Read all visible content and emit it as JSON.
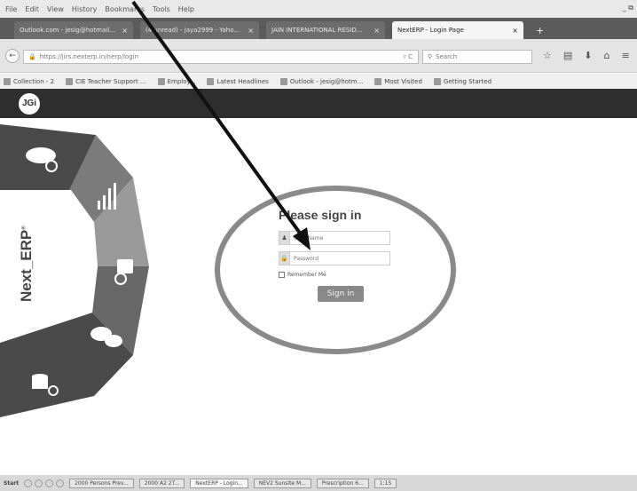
{
  "menubar": {
    "items": [
      "File",
      "Edit",
      "View",
      "History",
      "Bookmarks",
      "Tools",
      "Help"
    ],
    "window_controls": "_ ⧉"
  },
  "tabs": [
    {
      "label": "Outlook.com - jesig@hotmail...",
      "active": false,
      "close": "×"
    },
    {
      "label": "(4 unread) - jaya2999 - Yaho...",
      "active": false,
      "close": "×"
    },
    {
      "label": "JAIN INTERNATIONAL RESID...",
      "active": false,
      "close": "×"
    },
    {
      "label": "NextERP - Login Page",
      "active": true,
      "close": "×"
    }
  ],
  "new_tab": "+",
  "nav": {
    "url": "https://jirs.nexterp.in/nerp/login",
    "search_placeholder": "Search",
    "reload": "▿ C"
  },
  "bookmarks": [
    {
      "label": "Collection - 2"
    },
    {
      "label": "CIE Teacher Support ..."
    },
    {
      "label": "Employ..."
    },
    {
      "label": "Latest Headlines"
    },
    {
      "label": "Outlook - jesig@hotm..."
    },
    {
      "label": "Most Visited"
    },
    {
      "label": "Getting Started"
    }
  ],
  "app": {
    "logo_text": "JGi",
    "brand": "Next_ERP",
    "brand_mark": "®"
  },
  "login": {
    "heading": "Please sign in",
    "username_placeholder": "User Name",
    "password_placeholder": "Password",
    "remember_label": "Remember Me",
    "signin_label": "Sign in"
  },
  "taskbar": {
    "start": "Start",
    "items": [
      {
        "label": "2000 Persons Prev..."
      },
      {
        "label": "2000 A2 2T..."
      },
      {
        "label": "NextERP - Login...",
        "active": true
      },
      {
        "label": "NEV2 Sunsite M..."
      },
      {
        "label": "Prescription 6..."
      },
      {
        "label": "1:15"
      }
    ]
  },
  "colors": {
    "header_bg": "#2e2e2e",
    "wheel_dark": "#4a4a4a",
    "wheel_light": "#7b7b7b",
    "annotation": "#111111",
    "ellipse": "#8a8a8a"
  }
}
